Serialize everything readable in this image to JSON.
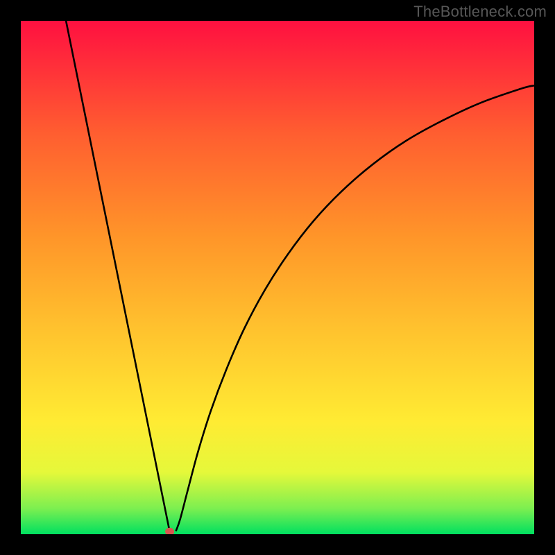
{
  "watermark": "TheBottleneck.com",
  "chart_data": {
    "type": "line",
    "title": "",
    "xlabel": "",
    "ylabel": "",
    "xlim": [
      0,
      1
    ],
    "ylim": [
      0,
      1
    ],
    "background_gradient": {
      "stops": [
        {
          "offset": 0.0,
          "color": "#00E060"
        },
        {
          "offset": 0.05,
          "color": "#7CEF50"
        },
        {
          "offset": 0.12,
          "color": "#E5F83A"
        },
        {
          "offset": 0.22,
          "color": "#FFEB33"
        },
        {
          "offset": 0.4,
          "color": "#FFC22E"
        },
        {
          "offset": 0.58,
          "color": "#FF9529"
        },
        {
          "offset": 0.78,
          "color": "#FF5E30"
        },
        {
          "offset": 1.0,
          "color": "#FF1040"
        }
      ]
    },
    "marker": {
      "x": 0.29,
      "y": 0.005,
      "color": "#d9534f"
    },
    "left_segment": {
      "x1": 0.088,
      "y1": 1.0,
      "x2": 0.29,
      "y2": 0.005
    },
    "right_curve": [
      {
        "x": 0.302,
        "y": 0.006
      },
      {
        "x": 0.31,
        "y": 0.028
      },
      {
        "x": 0.325,
        "y": 0.085
      },
      {
        "x": 0.345,
        "y": 0.16
      },
      {
        "x": 0.37,
        "y": 0.24
      },
      {
        "x": 0.4,
        "y": 0.32
      },
      {
        "x": 0.435,
        "y": 0.4
      },
      {
        "x": 0.475,
        "y": 0.475
      },
      {
        "x": 0.52,
        "y": 0.545
      },
      {
        "x": 0.57,
        "y": 0.61
      },
      {
        "x": 0.625,
        "y": 0.668
      },
      {
        "x": 0.685,
        "y": 0.72
      },
      {
        "x": 0.75,
        "y": 0.766
      },
      {
        "x": 0.82,
        "y": 0.805
      },
      {
        "x": 0.895,
        "y": 0.84
      },
      {
        "x": 0.975,
        "y": 0.868
      },
      {
        "x": 1.0,
        "y": 0.874
      }
    ]
  }
}
